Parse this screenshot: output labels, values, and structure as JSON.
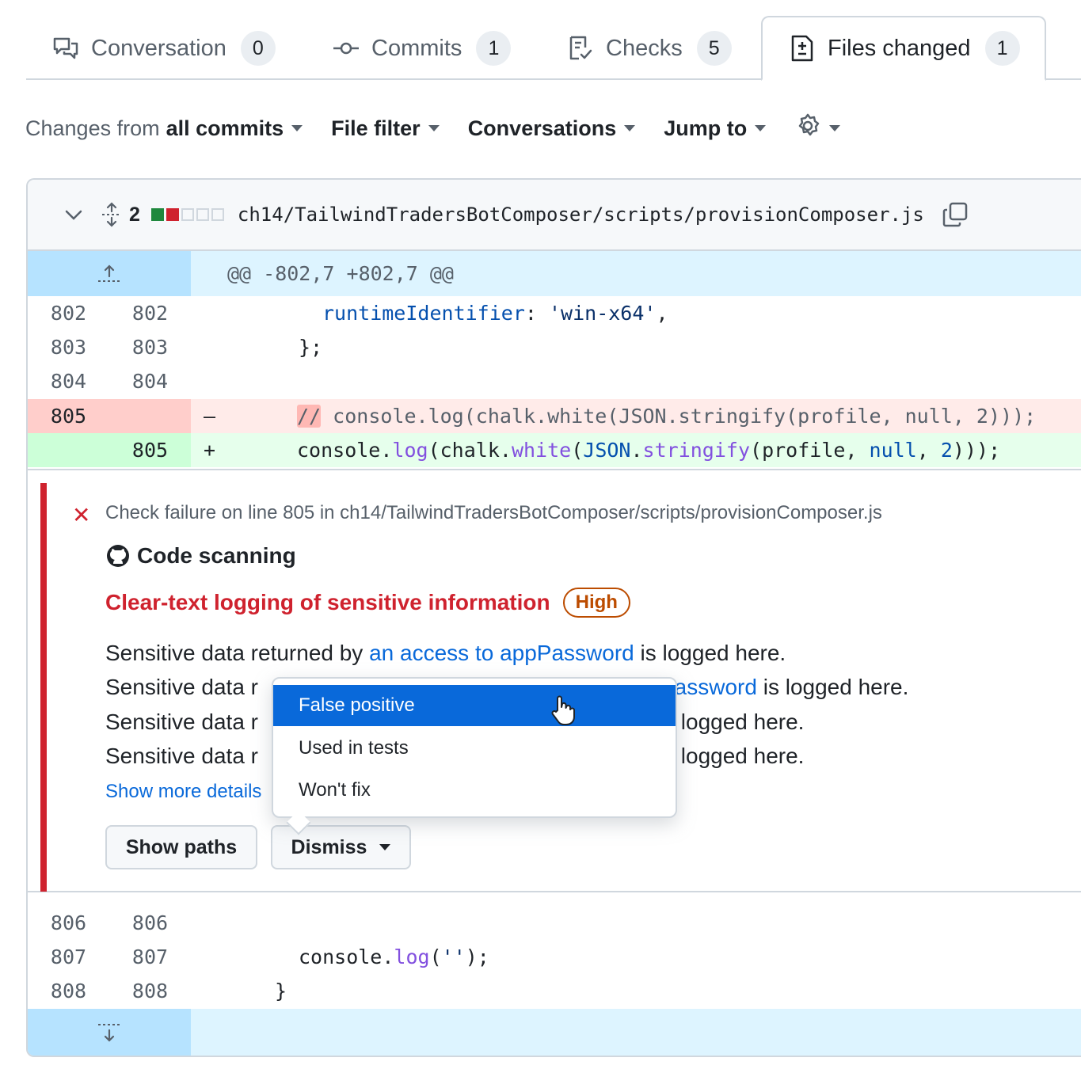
{
  "tabs": [
    {
      "label": "Conversation",
      "count": "0",
      "icon": "comment-discussion-icon"
    },
    {
      "label": "Commits",
      "count": "1",
      "icon": "git-commit-icon"
    },
    {
      "label": "Checks",
      "count": "5",
      "icon": "checklist-icon"
    },
    {
      "label": "Files changed",
      "count": "1",
      "icon": "file-diff-icon"
    }
  ],
  "toolbar": {
    "changes_prefix": "Changes from",
    "changes_value": "all commits",
    "file_filter": "File filter",
    "conversations": "Conversations",
    "jump_to": "Jump to",
    "settings_icon": "gear-icon"
  },
  "file": {
    "changes_count": "2",
    "path": "ch14/TailwindTradersBotComposer/scripts/provisionComposer.js",
    "diffstat": {
      "additions": 1,
      "deletions": 1,
      "neutral": 3
    }
  },
  "diff": {
    "hunk_header": "@@ -802,7 +802,7 @@",
    "lines": [
      {
        "old": "802",
        "new": "802",
        "code": "runtimeIdentifier: 'win-x64',"
      },
      {
        "old": "803",
        "new": "803",
        "code": "};"
      },
      {
        "old": "804",
        "new": "804",
        "code": ""
      },
      {
        "old": "805",
        "new": "",
        "sign": "–",
        "comment": "//",
        "code": " console.log(chalk.white(JSON.stringify(profile, null, 2)));"
      },
      {
        "old": "",
        "new": "805",
        "sign": "+",
        "code": "console.log(chalk.white(JSON.stringify(profile, null, 2)));"
      }
    ],
    "after_lines": [
      {
        "old": "806",
        "new": "806",
        "code": ""
      },
      {
        "old": "807",
        "new": "807",
        "code": "console.log('');"
      },
      {
        "old": "808",
        "new": "808",
        "code": "}"
      }
    ]
  },
  "alert": {
    "check_failure": "Check failure on line 805 in ch14/TailwindTradersBotComposer/scripts/provisionComposer.js",
    "tool": "Code scanning",
    "title": "Clear-text logging of sensitive information",
    "severity": "High",
    "messages": [
      {
        "prefix": "Sensitive data returned by ",
        "link": "an access to appPassword",
        "suffix": " is logged here."
      },
      {
        "prefix": "Sensitive data r",
        "link": "Password",
        "suffix": " is logged here."
      },
      {
        "prefix": "Sensitive data r",
        "link": "",
        "suffix": "s logged here."
      },
      {
        "prefix": "Sensitive data r",
        "link": "",
        "suffix": "s logged here."
      }
    ],
    "show_more": "Show more details",
    "show_paths": "Show paths",
    "dismiss": "Dismiss"
  },
  "dismiss_menu": {
    "items": [
      "False positive",
      "Used in tests",
      "Won't fix"
    ],
    "selected": 0
  },
  "colors": {
    "accent_blue": "#0969da",
    "danger_red": "#cf222e",
    "high_orange": "#bc4c00"
  }
}
